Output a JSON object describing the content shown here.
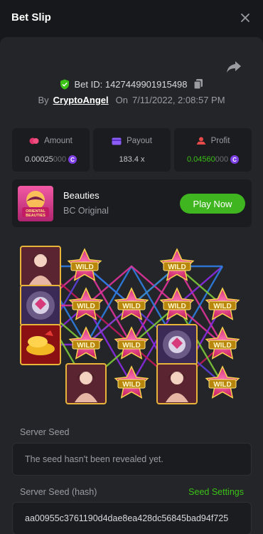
{
  "header": {
    "title": "Bet Slip"
  },
  "bet": {
    "id_label": "Bet ID: 142744990191549​8",
    "by_label": "By",
    "username": "CryptoAngel",
    "on_label": "On",
    "date": "7/11/2022, 2:08:57 PM"
  },
  "stats": {
    "amount": {
      "label": "Amount",
      "value_main": "0.00025",
      "value_dim": "000"
    },
    "payout": {
      "label": "Payout",
      "value": "183.4 x"
    },
    "profit": {
      "label": "Profit",
      "value_main": "0.04560",
      "value_dim": "000"
    }
  },
  "game": {
    "name": "Beauties",
    "provider": "BC Original",
    "thumb_text_1": "ORIENTAL",
    "thumb_text_2": "BEAUTIES",
    "play_label": "Play Now"
  },
  "board": {
    "wild_label": "WILD",
    "line_colors": [
      "#e0339a",
      "#8a2be2",
      "#2f7de0",
      "#7dc83a",
      "#c2185b",
      "#5b3fd9"
    ]
  },
  "server_seed": {
    "label": "Server Seed",
    "value": "The seed hasn't been revealed yet."
  },
  "server_seed_hash": {
    "label": "Server Seed (hash)",
    "settings_link": "Seed Settings",
    "value": "aa00955c3761190d4dae8ea428dc56845bad94f725"
  },
  "colors": {
    "accent": "#3fb620",
    "coin": "#7b3fe4",
    "background": "#17181b",
    "panel": "#232528"
  }
}
